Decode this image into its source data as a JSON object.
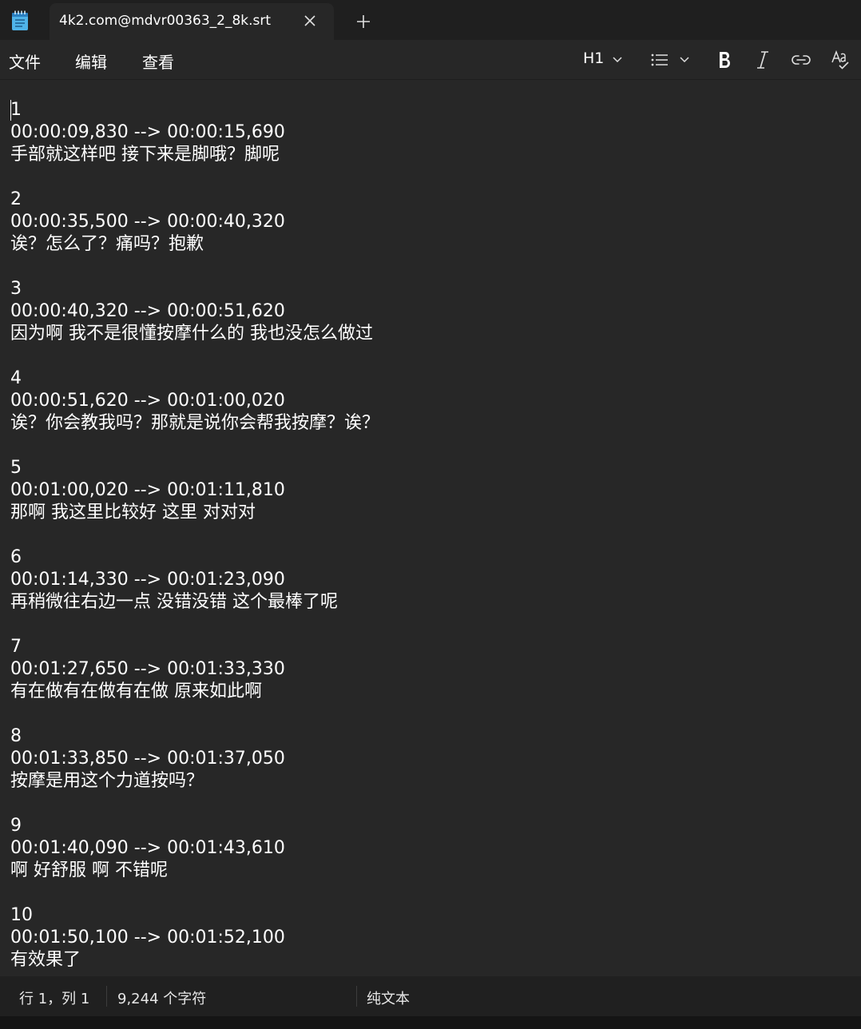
{
  "tab": {
    "title": "4k2.com@mdvr00363_2_8k.srt"
  },
  "menu": {
    "file": "文件",
    "edit": "编辑",
    "view": "查看"
  },
  "toolbar": {
    "heading": "H1"
  },
  "subtitles": [
    {
      "index": "1",
      "time": "00:00:09,830 --> 00:00:15,690",
      "text": "手部就这样吧 接下来是脚哦？脚呢"
    },
    {
      "index": "2",
      "time": "00:00:35,500 --> 00:00:40,320",
      "text": "诶？怎么了？痛吗？抱歉"
    },
    {
      "index": "3",
      "time": "00:00:40,320 --> 00:00:51,620",
      "text": "因为啊 我不是很懂按摩什么的 我也没怎么做过"
    },
    {
      "index": "4",
      "time": "00:00:51,620 --> 00:01:00,020",
      "text": "诶？你会教我吗？那就是说你会帮我按摩？诶？"
    },
    {
      "index": "5",
      "time": "00:01:00,020 --> 00:01:11,810",
      "text": "那啊 我这里比较好 这里 对对对"
    },
    {
      "index": "6",
      "time": "00:01:14,330 --> 00:01:23,090",
      "text": "再稍微往右边一点 没错没错 这个最棒了呢"
    },
    {
      "index": "7",
      "time": "00:01:27,650 --> 00:01:33,330",
      "text": "有在做有在做有在做 原来如此啊"
    },
    {
      "index": "8",
      "time": "00:01:33,850 --> 00:01:37,050",
      "text": "按摩是用这个力道按吗？"
    },
    {
      "index": "9",
      "time": "00:01:40,090 --> 00:01:43,610",
      "text": "啊 好舒服 啊 不错呢"
    },
    {
      "index": "10",
      "time": "00:01:50,100 --> 00:01:52,100",
      "text": "有效果了"
    }
  ],
  "status": {
    "position": "行 1，列 1",
    "char_count": "9,244 个字符",
    "file_type": "纯文本"
  }
}
